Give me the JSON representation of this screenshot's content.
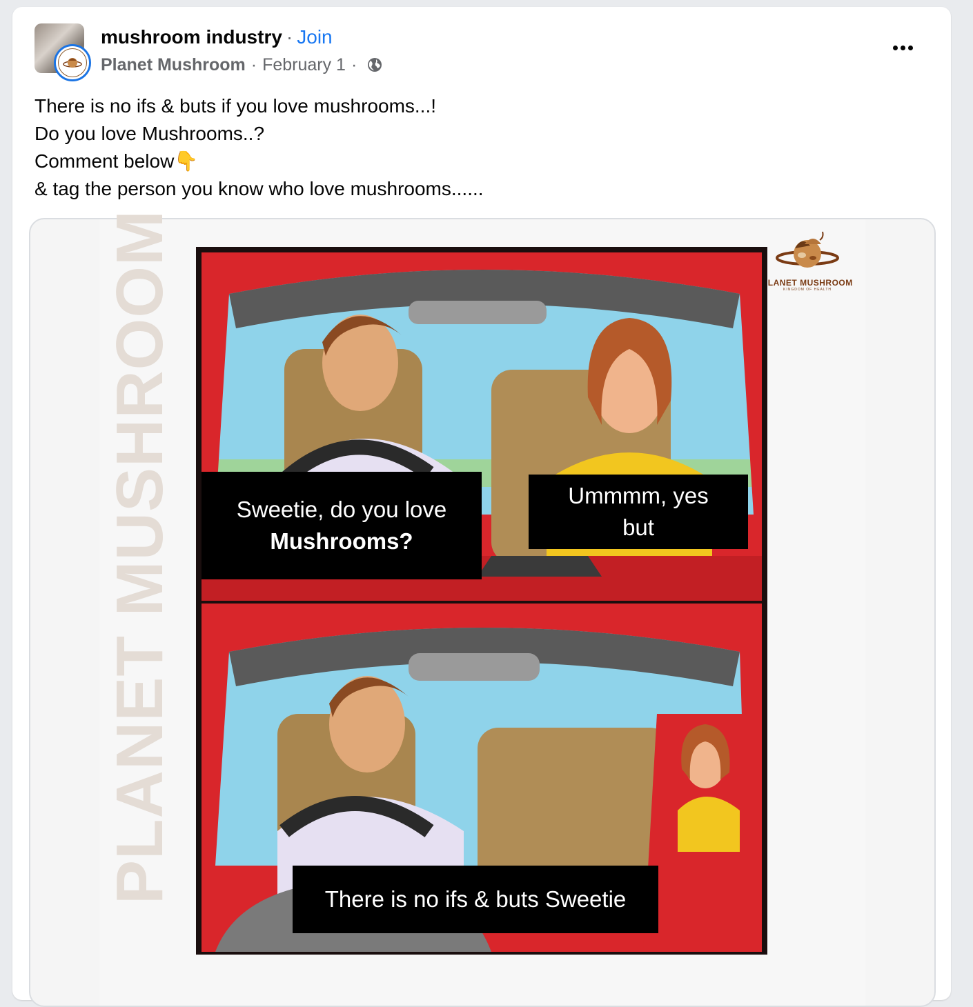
{
  "post": {
    "group_name": "mushroom industry",
    "separator": "·",
    "join_label": "Join",
    "page_name": "Planet Mushroom",
    "date": "February 1",
    "text_lines": [
      "There is no ifs & buts if you love mushrooms...!",
      "Do you love Mushrooms..?",
      "Comment below👇",
      "& tag the person you know who love mushrooms......"
    ]
  },
  "media": {
    "watermark_text": "PLANET MUSHROOM",
    "logo_name": "PLANET MUSHROOM",
    "logo_subtitle": "KINGDOM OF HEALTH",
    "captions": {
      "man_line1": "Sweetie, do you love",
      "man_line2": "Mushrooms?",
      "woman_line1": "Ummmm, yes",
      "woman_line2": "but",
      "bottom": "There is no ifs & buts Sweetie"
    }
  },
  "icons": {
    "more": "more-horizontal-icon",
    "privacy": "globe-icon"
  },
  "colors": {
    "link_blue": "#1877f2",
    "secondary_text": "#65676b",
    "car_red": "#d9262b"
  }
}
